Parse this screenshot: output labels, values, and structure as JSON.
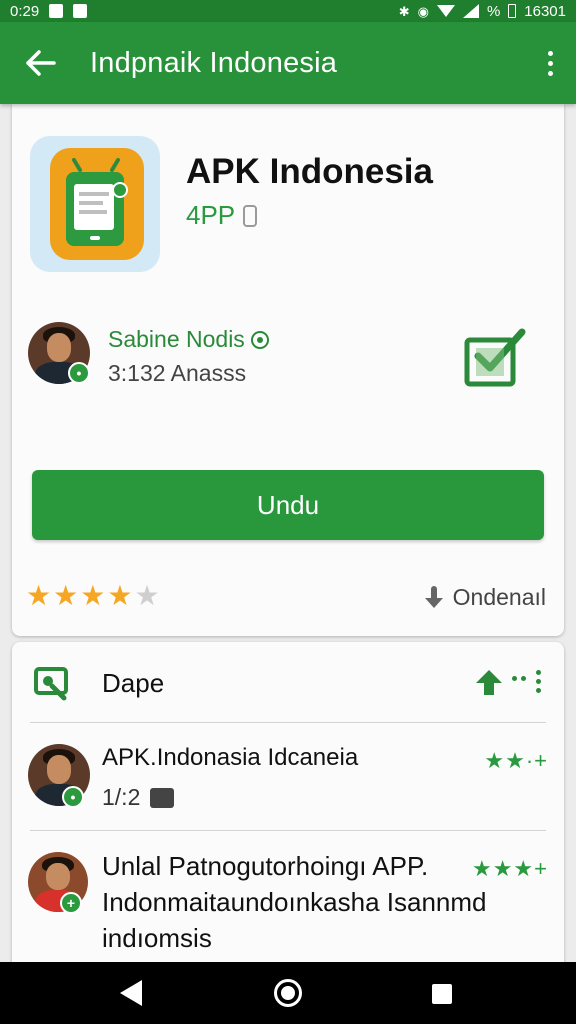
{
  "status_bar": {
    "time": "0:29",
    "battery_text": "%",
    "clock_right": "16301",
    "icons": [
      "notification-icon",
      "notification-icon",
      "bluetooth-icon",
      "location-icon",
      "wifi-icon",
      "signal-icon",
      "battery-icon"
    ]
  },
  "app_bar": {
    "title": "Indpnaik Indonesia",
    "back_icon": "arrow-left-icon",
    "more_icon": "more-vertical-icon",
    "background": "#27923a"
  },
  "app_card": {
    "name": "APK Indonesia",
    "subtitle": "4PP",
    "developer": {
      "name": "Sabine Nodis",
      "count_text": "3:132 Anasss"
    },
    "primary_button": "Undu",
    "rating": {
      "value": 4,
      "max": 5,
      "star_color": "#f5a623",
      "empty_color": "#cfcfcf"
    },
    "order_label": "Ondenaıl"
  },
  "section": {
    "title": "Dape",
    "reviews": [
      {
        "title": "APK.Indonasia Idcaneia",
        "meta": "1/:2",
        "stars": "★★·+"
      },
      {
        "body": "Unlal Patnogutorhoingı APP. Indonmaitaundoınkasha Isannmd indıomsis",
        "stars": "★★★+"
      }
    ]
  },
  "nav_bar": {
    "icons": [
      "back-triangle-icon",
      "home-circle-icon",
      "recent-square-icon"
    ]
  },
  "colors": {
    "primary": "#29983c",
    "primary_dark": "#1f7f2e",
    "text": "#111111"
  }
}
